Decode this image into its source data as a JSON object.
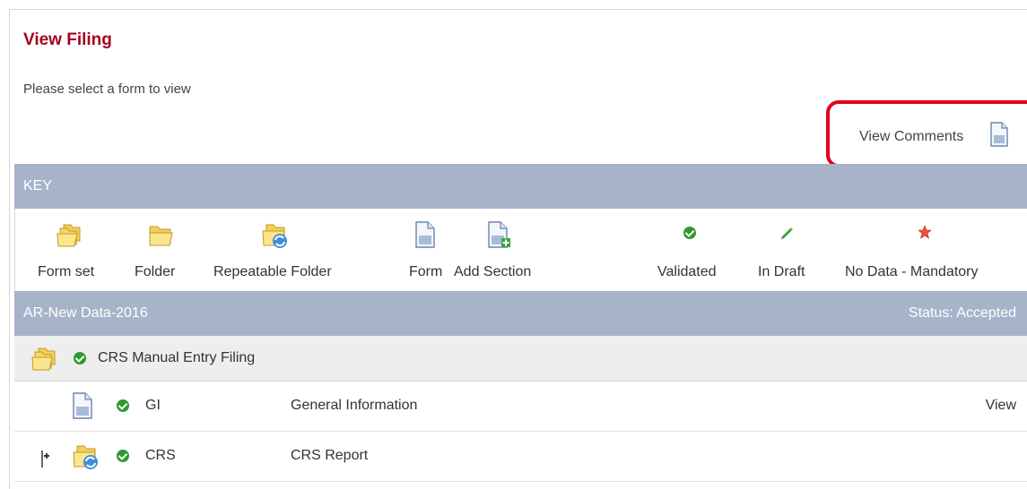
{
  "page": {
    "title": "View Filing",
    "instruction": "Please select a form to view",
    "view_comments_label": "View Comments"
  },
  "key": {
    "header": "KEY",
    "items": [
      {
        "label": "Form set",
        "icon": "form-set-icon"
      },
      {
        "label": "Folder",
        "icon": "folder-icon"
      },
      {
        "label": "Repeatable Folder",
        "icon": "repeatable-folder-icon"
      },
      {
        "label": "Form",
        "icon": "form-icon"
      },
      {
        "label": "Add Section",
        "icon": "add-section-icon"
      },
      {
        "label": "Validated",
        "icon": "validated-icon"
      },
      {
        "label": "In Draft",
        "icon": "in-draft-icon"
      },
      {
        "label": "No Data - Mandatory",
        "icon": "no-data-mandatory-icon"
      }
    ]
  },
  "filing": {
    "name": "AR-New Data-2016",
    "status": "Status: Accepted",
    "group": {
      "label": "CRS Manual Entry Filing",
      "icon": "form-set-icon",
      "status": "validated"
    },
    "rows": [
      {
        "code": "GI",
        "name": "General Information",
        "action": "View",
        "icon": "form-icon",
        "status": "validated",
        "expandable": false
      },
      {
        "code": "CRS",
        "name": "CRS Report",
        "action": "",
        "icon": "repeatable-folder-icon",
        "status": "validated",
        "expandable": true
      }
    ]
  },
  "colors": {
    "title": "#a50021",
    "bar": "#a7b3c9",
    "highlight": "#e2001a",
    "validated": "#2f9a2f",
    "folder": "#f5d76e"
  }
}
